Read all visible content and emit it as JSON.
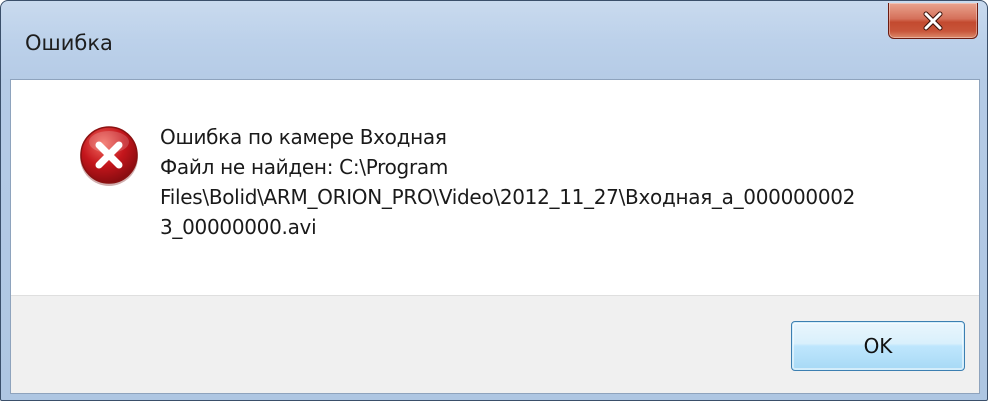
{
  "window": {
    "title": "Ошибка",
    "close_label": "x"
  },
  "dialog": {
    "icon": "error-icon",
    "message_lines": [
      "Ошибка по камере Входная",
      "Файл не найден: C:\\Program",
      "Files\\Bolid\\ARM_ORION_PRO\\Video\\2012_11_27\\Входная_a_000000002",
      "3_00000000.avi"
    ],
    "ok_label": "OK"
  },
  "colors": {
    "close_button": "#c8553a",
    "error_icon": "#c4161c",
    "ok_button_border": "#3c7fb1"
  }
}
